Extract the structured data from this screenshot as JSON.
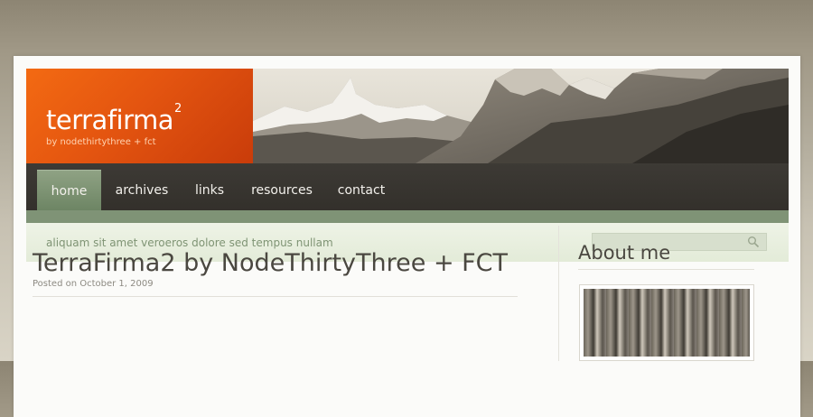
{
  "site": {
    "title": "terrafirma",
    "title_sup": "2",
    "byline": "by nodethirtythree + fct"
  },
  "nav": {
    "items": [
      {
        "label": "home",
        "active": true
      },
      {
        "label": "archives",
        "active": false
      },
      {
        "label": "links",
        "active": false
      },
      {
        "label": "resources",
        "active": false
      },
      {
        "label": "contact",
        "active": false
      }
    ]
  },
  "subbar": {
    "tagline": "aliquam sit amet veroeros dolore sed tempus nullam",
    "search_icon": "magnifier-icon"
  },
  "post": {
    "title": "TerraFirma2 by NodeThirtyThree + FCT",
    "date": "Posted on October 1, 2009"
  },
  "sidebar": {
    "about_title": "About me"
  },
  "colors": {
    "logo_orange": "#e45510",
    "nav_dark": "#36332e",
    "nav_active_green": "#7f9376",
    "subbar_green": "#e9efe0",
    "tagline_green": "#7f9474"
  }
}
